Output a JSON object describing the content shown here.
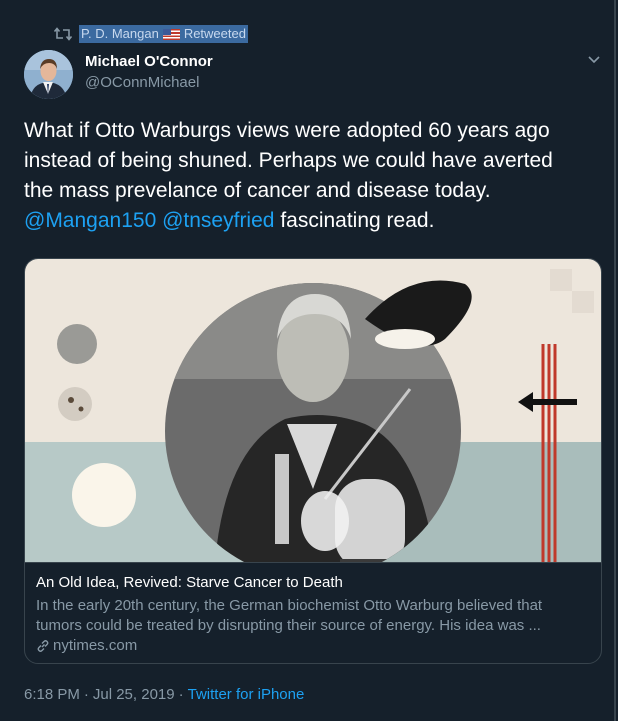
{
  "retweet": {
    "icon": "retweet-icon",
    "name": "P. D. Mangan",
    "flag": "us-flag-icon",
    "suffix": "Retweeted"
  },
  "author": {
    "name": "Michael O'Connor",
    "handle": "@OConnMichael"
  },
  "tweet": {
    "line1": "What if Otto Warburgs views were adopted 60 years ago",
    "line2": "instead of being shuned. Perhaps we could have averted",
    "line3": "the mass prevelance of cancer and disease today.",
    "mention1": "@Mangan150",
    "mention2": "@tnseyfried",
    "tail": "fascinating read."
  },
  "card": {
    "title": "An Old Idea, Revived: Starve Cancer to Death",
    "description": "In the early 20th century, the German biochemist Otto Warburg believed that tumors could be treated by disrupting their source of energy. His idea was ...",
    "domain": "nytimes.com"
  },
  "footer": {
    "time": "6:18 PM",
    "separator": "·",
    "date": "Jul 25, 2019",
    "separator2": "·",
    "source": "Twitter for iPhone"
  },
  "colors": {
    "background": "#15202b",
    "accent": "#1da1f2",
    "secondary_text": "#8899a6"
  }
}
